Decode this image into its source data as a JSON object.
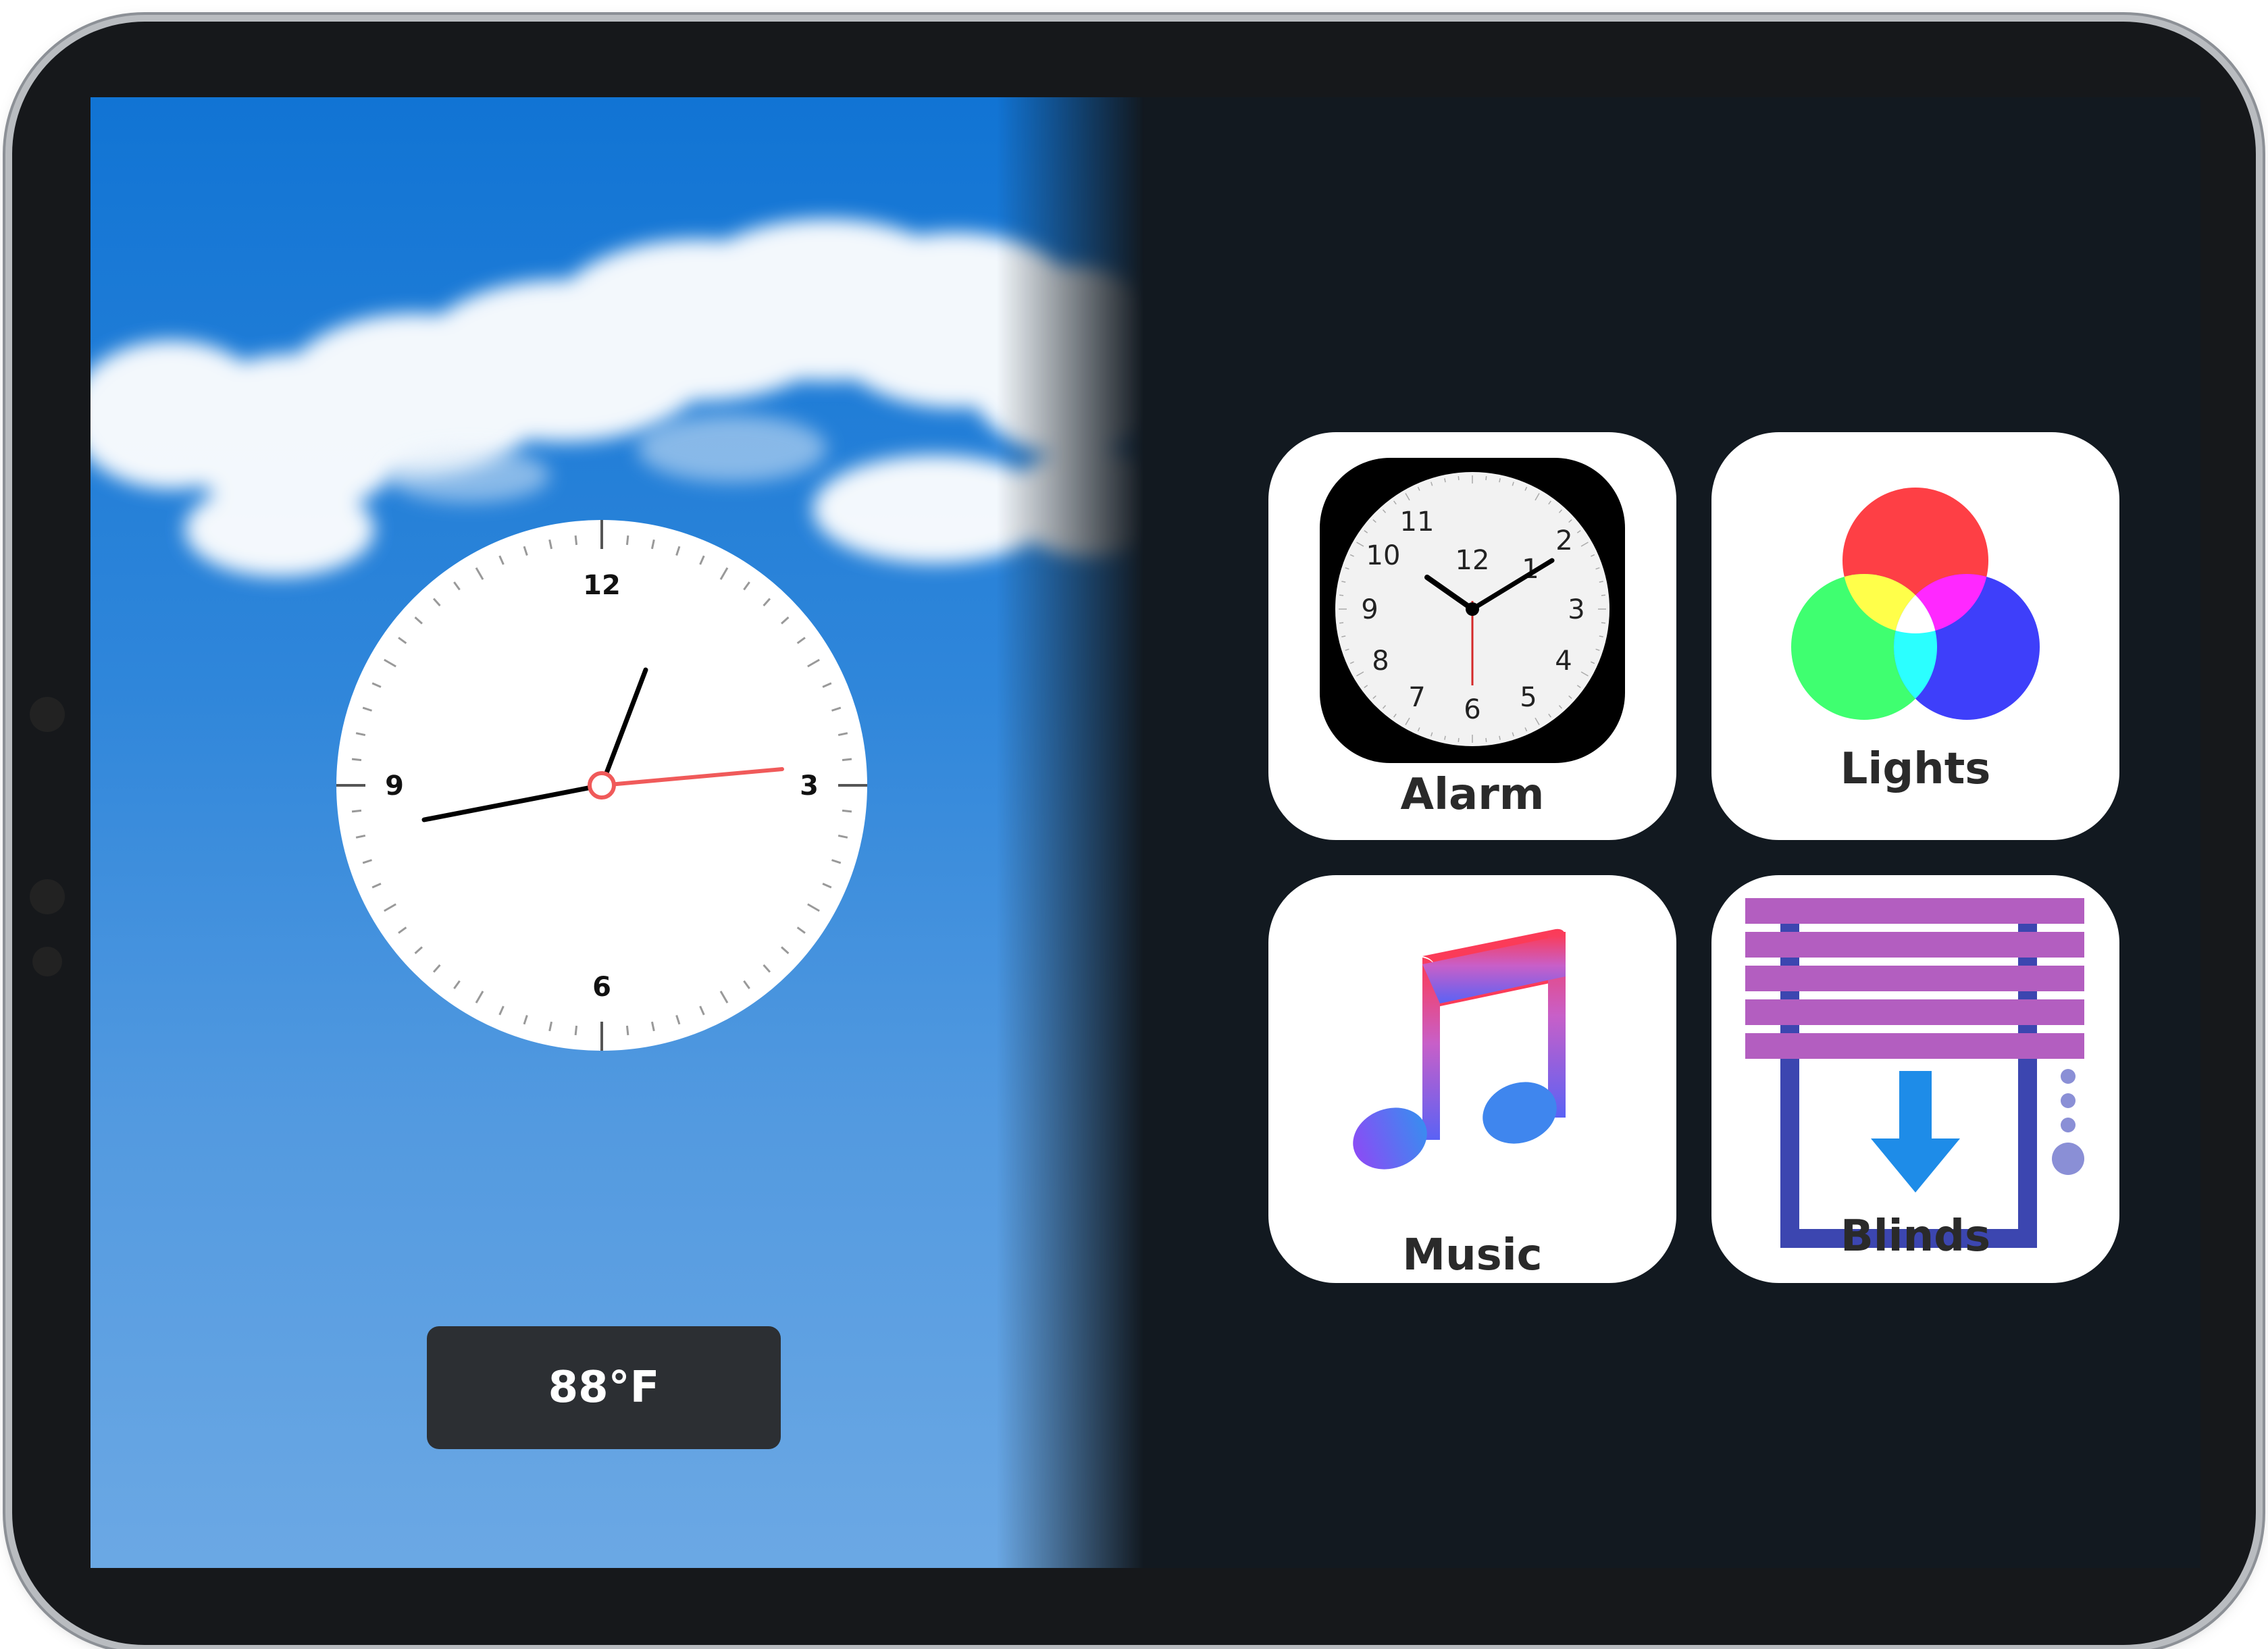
{
  "clock": {
    "numerals": [
      "12",
      "3",
      "6",
      "9"
    ]
  },
  "weather": {
    "temperature": "88°F"
  },
  "tiles": {
    "alarm": {
      "label": "Alarm",
      "numerals": [
        "12",
        "1",
        "2",
        "3",
        "4",
        "5",
        "6",
        "7",
        "8",
        "9",
        "10",
        "11"
      ]
    },
    "lights": {
      "label": "Lights"
    },
    "music": {
      "label": "Music"
    },
    "blinds": {
      "label": "Blinds"
    }
  },
  "colors": {
    "second_hand": "#f05a5a",
    "tile_bg": "#ffffff",
    "panel_bg": "#121920",
    "temp_bg": "#2c2f33",
    "light_red": "#fe3f45",
    "light_green": "#3fff70",
    "light_blue": "#3e3ffa",
    "blinds_slat": "#b35ec0",
    "blinds_frame": "#3c46b0",
    "blinds_arrow": "#1e8ce8"
  }
}
